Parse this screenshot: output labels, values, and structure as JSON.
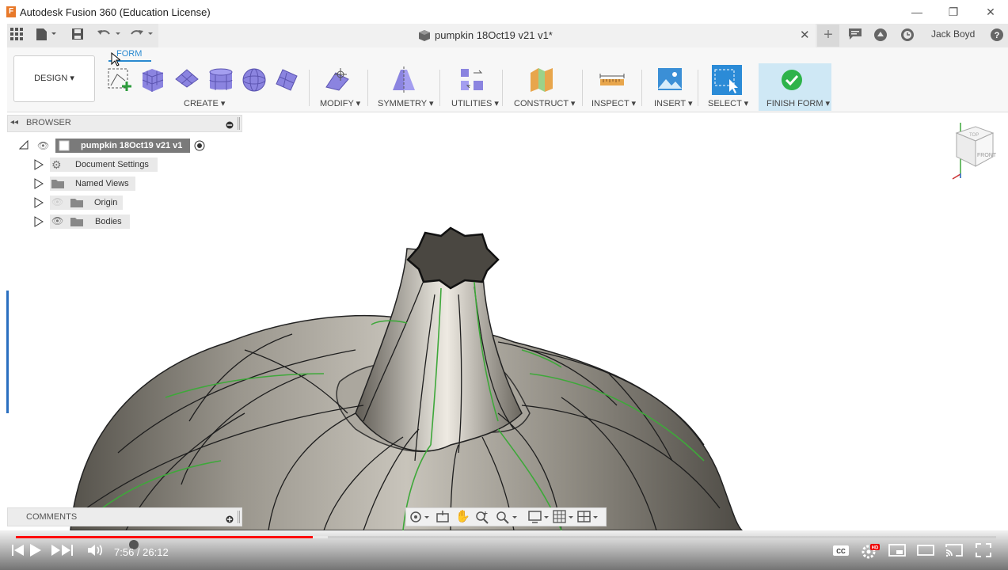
{
  "window": {
    "app_title": "Autodesk Fusion 360 (Education License)",
    "logo": "F"
  },
  "document": {
    "title": "pumpkin 18Oct19 v21 v1*"
  },
  "user": {
    "name": "Jack Boyd"
  },
  "toolbar": {
    "workspace": "DESIGN ▾",
    "active_tab": "FORM",
    "groups": [
      {
        "label": "CREATE ▾"
      },
      {
        "label": "MODIFY ▾"
      },
      {
        "label": "SYMMETRY ▾"
      },
      {
        "label": "UTILITIES ▾"
      },
      {
        "label": "CONSTRUCT ▾"
      },
      {
        "label": "INSPECT ▾"
      },
      {
        "label": "INSERT ▾"
      },
      {
        "label": "SELECT ▾"
      },
      {
        "label": "FINISH FORM ▾"
      }
    ]
  },
  "browser": {
    "label": "BROWSER",
    "root": "pumpkin 18Oct19 v21 v1",
    "items": [
      {
        "label": "Document Settings",
        "icon": "gear-icon"
      },
      {
        "label": "Named Views",
        "icon": "folder-icon"
      },
      {
        "label": "Origin",
        "icon": "folder-icon"
      },
      {
        "label": "Bodies",
        "icon": "folder-icon"
      }
    ]
  },
  "viewcube": {
    "top": "TOP",
    "front": "FRONT"
  },
  "comments": {
    "label": "COMMENTS"
  },
  "video": {
    "time": "7:56 / 26:12",
    "progress": 0.303,
    "buffered": 0.318
  },
  "colors": {
    "accent": "#2a8ad0",
    "finish": "#cfe8f5",
    "progress": "#ff0000"
  }
}
